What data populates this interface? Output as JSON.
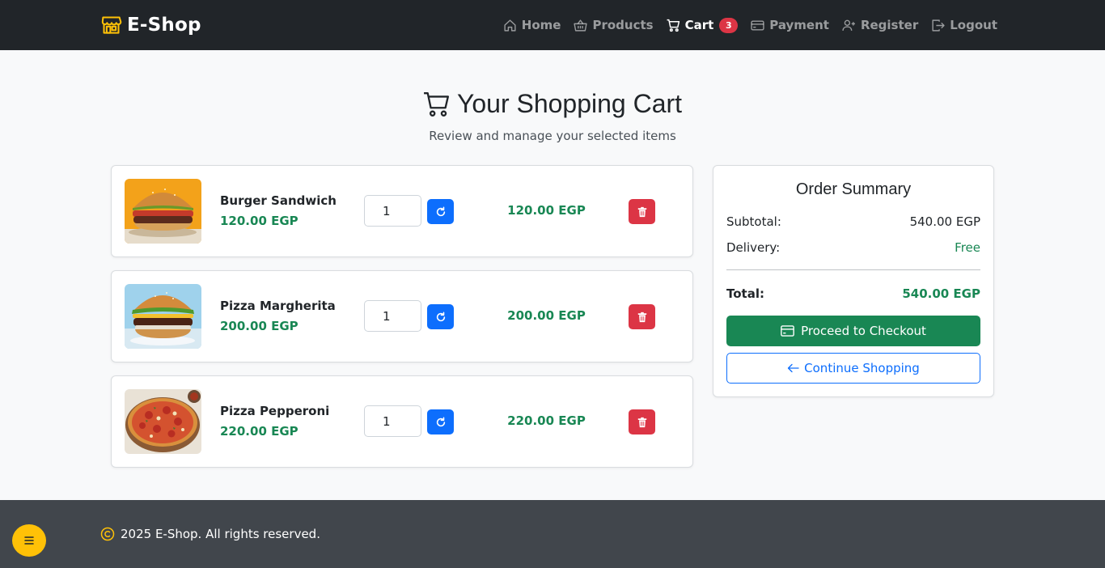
{
  "brand": {
    "name": "E-Shop",
    "icon": "shop-icon"
  },
  "nav": [
    {
      "label": "Home",
      "icon": "house-icon"
    },
    {
      "label": "Products",
      "icon": "basket-icon"
    },
    {
      "label": "Cart",
      "icon": "cart-icon",
      "badge": "3",
      "active": true
    },
    {
      "label": "Payment",
      "icon": "credit-card-icon"
    },
    {
      "label": "Register",
      "icon": "person-plus-icon"
    },
    {
      "label": "Logout",
      "icon": "logout-icon"
    }
  ],
  "header": {
    "title": "Your Shopping Cart",
    "subtitle": "Review and manage your selected items"
  },
  "cart": {
    "currency": "EGP",
    "items": [
      {
        "name": "Burger Sandwich",
        "price": "120.00 EGP",
        "quantity": "1",
        "total": "120.00 EGP",
        "image": "burger-photo"
      },
      {
        "name": "Pizza Margherita",
        "price": "200.00 EGP",
        "quantity": "1",
        "total": "200.00 EGP",
        "image": "burger-photo"
      },
      {
        "name": "Pizza Pepperoni",
        "price": "220.00 EGP",
        "quantity": "1",
        "total": "220.00 EGP",
        "image": "pizza-photo"
      }
    ]
  },
  "summary": {
    "title": "Order Summary",
    "subtotal_label": "Subtotal:",
    "subtotal_value": "540.00 EGP",
    "delivery_label": "Delivery:",
    "delivery_value": "Free",
    "total_label": "Total:",
    "total_value": "540.00 EGP",
    "checkout_label": "Proceed to Checkout",
    "continue_label": "Continue Shopping"
  },
  "footer": {
    "text": "2025 E-Shop. All rights reserved."
  },
  "colors": {
    "navbar": "#212529",
    "success": "#198754",
    "primary": "#0d6efd",
    "danger": "#dc3545",
    "warning": "#ffc107",
    "footer": "#41464c"
  }
}
